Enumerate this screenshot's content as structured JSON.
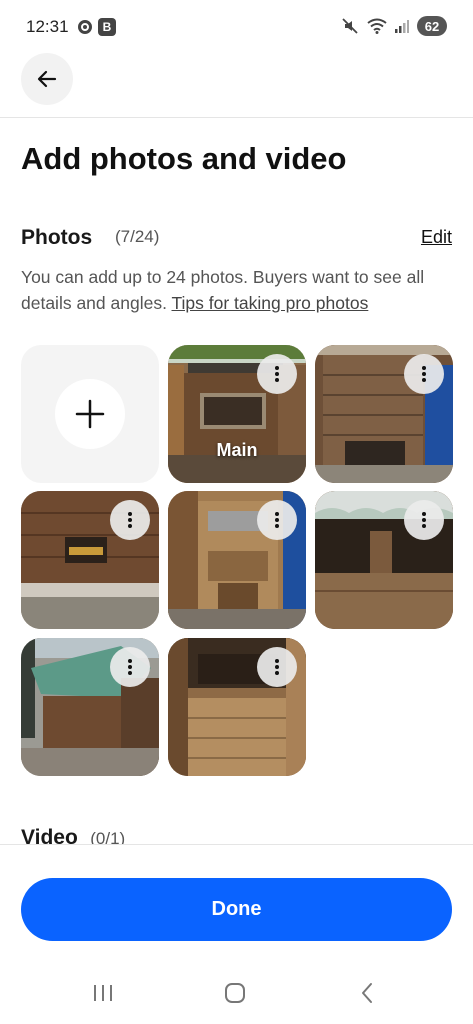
{
  "status_bar": {
    "time": "12:31",
    "b_badge": "B",
    "battery": "62"
  },
  "header": {
    "back_icon": "arrow-left-icon"
  },
  "page": {
    "title": "Add photos and video"
  },
  "photos": {
    "title": "Photos",
    "count": "(7/24)",
    "edit_label": "Edit",
    "description": "You can add up to 24 photos. Buyers want to see all details and angles. ",
    "tips_link": "Tips for taking pro photos",
    "main_label": "Main",
    "items": [
      {
        "name": "photo-1",
        "main": true
      },
      {
        "name": "photo-2"
      },
      {
        "name": "photo-3"
      },
      {
        "name": "photo-4"
      },
      {
        "name": "photo-5"
      },
      {
        "name": "photo-6"
      },
      {
        "name": "photo-7"
      }
    ]
  },
  "video": {
    "title": "Video",
    "count": "(0/1)"
  },
  "footer": {
    "done_label": "Done"
  },
  "colors": {
    "accent": "#0a63ff",
    "text": "#191919",
    "muted": "#555555"
  }
}
